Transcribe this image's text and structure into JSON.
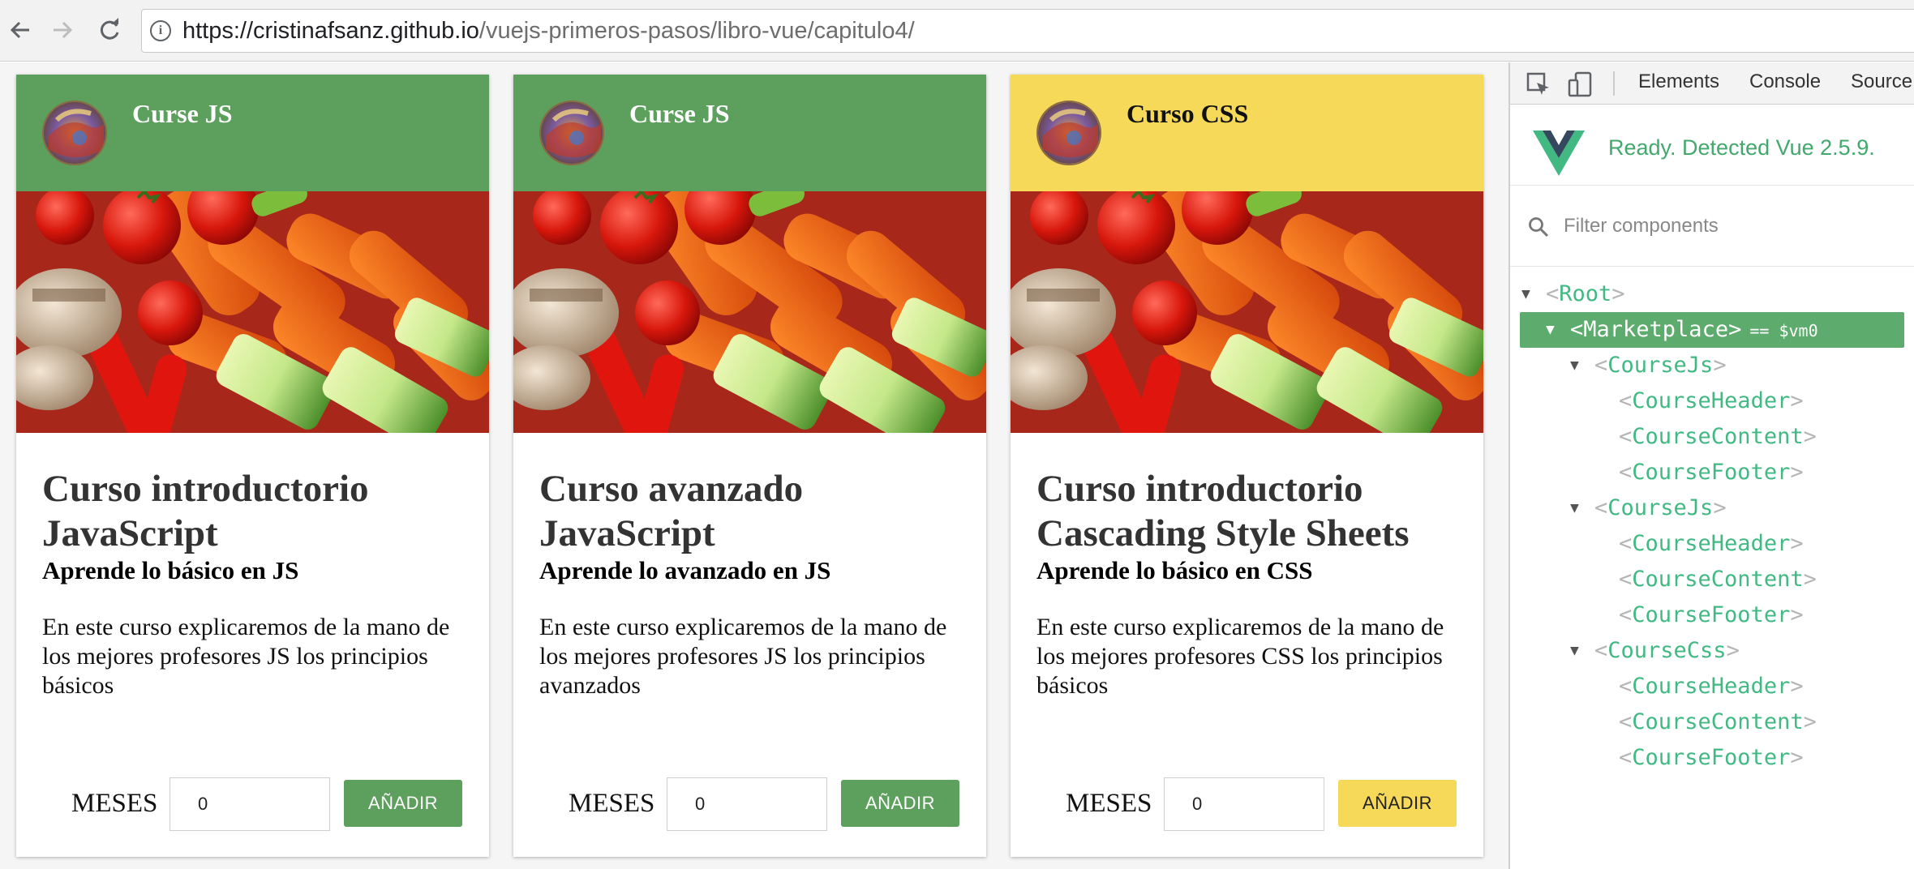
{
  "browser": {
    "url_host": "https://cristinafsanz.github.io",
    "url_path": "/vuejs-primeros-pasos/libro-vue/capitulo4/",
    "info_glyph": "i"
  },
  "cards": [
    {
      "header_title": "Curse JS",
      "header_color": "#5d9f5d",
      "header_text_color": "#ffffff",
      "title": "Curso introductorio JavaScript",
      "subtitle": "Aprende lo básico en JS",
      "description": "En este curso explicaremos de la mano de los mejores profesores JS los principios básicos",
      "months_label": "MESES",
      "months_value": "0",
      "button_label": "AÑADIR",
      "button_color": "#5d9f5d",
      "button_text_color": "#ffffff"
    },
    {
      "header_title": "Curse JS",
      "header_color": "#5d9f5d",
      "header_text_color": "#ffffff",
      "title": "Curso avanzado JavaScript",
      "subtitle": "Aprende lo avanzado en JS",
      "description": "En este curso explicaremos de la mano de los mejores profesores JS los principios avanzados",
      "months_label": "MESES",
      "months_value": "0",
      "button_label": "AÑADIR",
      "button_color": "#5d9f5d",
      "button_text_color": "#ffffff"
    },
    {
      "header_title": "Curso CSS",
      "header_color": "#f7d95a",
      "header_text_color": "#111111",
      "title": "Curso introductorio Cascading Style Sheets",
      "subtitle": "Aprende lo básico en CSS",
      "description": "En este curso explicaremos de la mano de los mejores profesores CSS los principios básicos",
      "months_label": "MESES",
      "months_value": "0",
      "button_label": "AÑADIR",
      "button_color": "#f7d95a",
      "button_text_color": "#222222"
    }
  ],
  "devtools": {
    "tabs": [
      "Elements",
      "Console",
      "Source"
    ],
    "vue_status": "Ready. Detected Vue 2.5.9.",
    "filter_placeholder": "Filter components",
    "selected_suffix": "== $vm0",
    "tree": [
      {
        "name": "Root",
        "open": true,
        "selected": false
      },
      {
        "name": "Marketplace",
        "open": true,
        "selected": true
      },
      {
        "name": "CourseJs",
        "open": true,
        "selected": false
      },
      {
        "name": "CourseHeader",
        "open": false,
        "selected": false
      },
      {
        "name": "CourseContent",
        "open": false,
        "selected": false
      },
      {
        "name": "CourseFooter",
        "open": false,
        "selected": false
      },
      {
        "name": "CourseJs",
        "open": true,
        "selected": false
      },
      {
        "name": "CourseHeader",
        "open": false,
        "selected": false
      },
      {
        "name": "CourseContent",
        "open": false,
        "selected": false
      },
      {
        "name": "CourseFooter",
        "open": false,
        "selected": false
      },
      {
        "name": "CourseCss",
        "open": true,
        "selected": false
      },
      {
        "name": "CourseHeader",
        "open": false,
        "selected": false
      },
      {
        "name": "CourseContent",
        "open": false,
        "selected": false
      },
      {
        "name": "CourseFooter",
        "open": false,
        "selected": false
      }
    ],
    "accent_color": "#42b983"
  }
}
